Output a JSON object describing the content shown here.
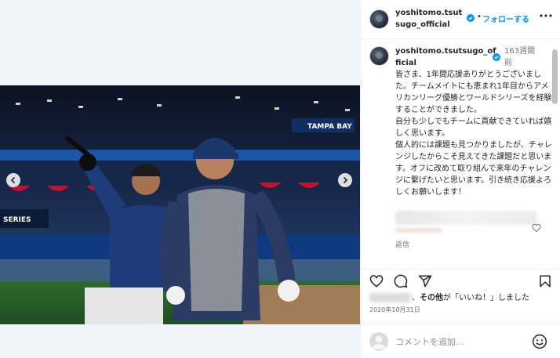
{
  "post": {
    "username": "yoshitomo.tsutsugo_official",
    "follow_label": "フォローする",
    "dot_separator": "•",
    "caption_username": "yoshitomo.tsutsugo_official",
    "time_ago": "163週間前",
    "caption": "皆さま、1年間応援ありがとうございました。チームメイトにも恵まれ1年目からアメリカンリーグ優勝とワールドシリーズを経験することができました。\n自分も少しでもチームに貢献できていれば嬉しく思います。\n個人的には課題も見つかりましたが、チャレンジしたからこそ見えてきた課題だと思います。オフに改めて取り組んで来年のチャレンジに繋げたいと思います。引き続き応援よろしくお願いします！",
    "reply_label": "返信",
    "likes_suffix": "その他",
    "likes_text": "が「いいね！」しました",
    "likes_separator": "、",
    "date": "2020年10月31日",
    "comment_placeholder": "コメントを追加..."
  },
  "icons": {
    "verified": "verified-badge-icon",
    "more": "more-horizontal-icon",
    "like": "heart-icon",
    "comment": "comment-bubble-icon",
    "share": "paper-plane-icon",
    "save": "bookmark-icon",
    "emoji": "smiley-icon",
    "prev": "chevron-left-icon",
    "next": "chevron-right-icon"
  },
  "colors": {
    "accent": "#0095f6",
    "text": "#262626",
    "muted": "#737373",
    "border": "#efefef",
    "media_bg": "#eef6fb"
  }
}
